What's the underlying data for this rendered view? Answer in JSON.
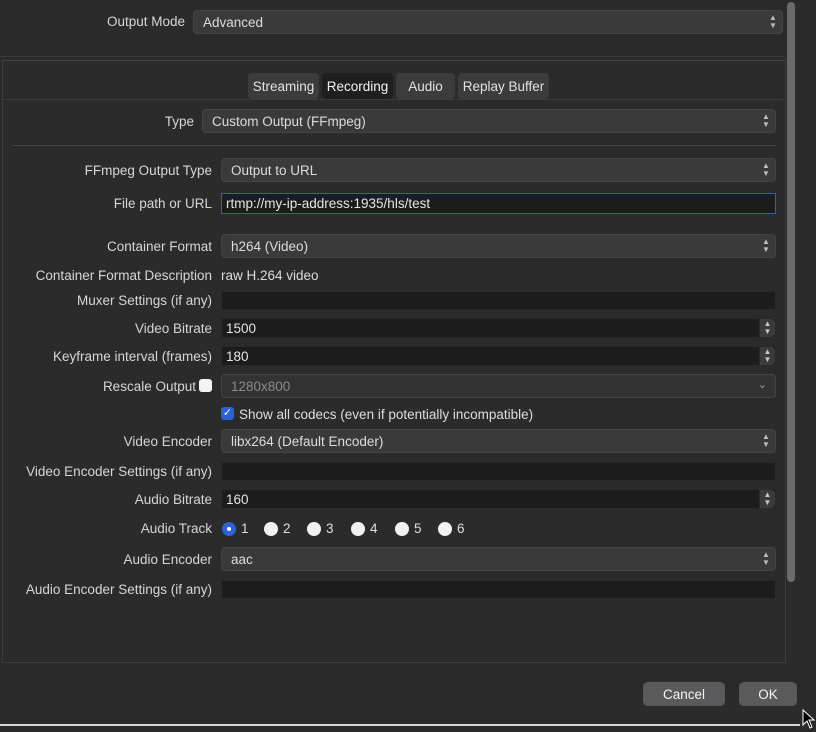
{
  "output_mode": {
    "label": "Output Mode",
    "value": "Advanced"
  },
  "tabs": [
    {
      "label": "Streaming"
    },
    {
      "label": "Recording"
    },
    {
      "label": "Audio"
    },
    {
      "label": "Replay Buffer"
    }
  ],
  "active_tab": "Recording",
  "type": {
    "label": "Type",
    "value": "Custom Output (FFmpeg)"
  },
  "ffmpeg_output_type": {
    "label": "FFmpeg Output Type",
    "value": "Output to URL"
  },
  "file_path": {
    "label": "File path or URL",
    "value": "rtmp://my-ip-address:1935/hls/test"
  },
  "container_format": {
    "label": "Container Format",
    "value": "h264 (Video)"
  },
  "container_desc": {
    "label": "Container Format Description",
    "value": "raw H.264 video"
  },
  "muxer_settings": {
    "label": "Muxer Settings (if any)",
    "value": ""
  },
  "video_bitrate": {
    "label": "Video Bitrate",
    "value": "1500"
  },
  "keyframe_interval": {
    "label": "Keyframe interval (frames)",
    "value": "180"
  },
  "rescale_output": {
    "label": "Rescale Output",
    "checked": false,
    "value": "1280x800"
  },
  "show_all_codecs": {
    "label": "Show all codecs (even if potentially incompatible)",
    "checked": true
  },
  "video_encoder": {
    "label": "Video Encoder",
    "value": "libx264 (Default Encoder)"
  },
  "video_encoder_settings": {
    "label": "Video Encoder Settings (if any)",
    "value": ""
  },
  "audio_bitrate": {
    "label": "Audio Bitrate",
    "value": "160"
  },
  "audio_track": {
    "label": "Audio Track",
    "options": [
      "1",
      "2",
      "3",
      "4",
      "5",
      "6"
    ],
    "selected": "1"
  },
  "audio_encoder": {
    "label": "Audio Encoder",
    "value": "aac"
  },
  "audio_encoder_settings": {
    "label": "Audio Encoder Settings (if any)",
    "value": ""
  },
  "buttons": {
    "cancel": "Cancel",
    "ok": "OK"
  },
  "colors": {
    "accent": "#2a63d6",
    "background": "#2b2b2c",
    "field": "#3a3a3b",
    "input": "#1c1c1d"
  }
}
